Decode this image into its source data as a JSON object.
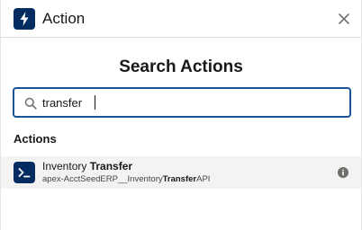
{
  "header": {
    "title": "Action",
    "icon": "lightning-icon",
    "close_icon": "close-icon"
  },
  "search": {
    "heading": "Search Actions",
    "value": "transfer",
    "icon": "search-icon"
  },
  "results": {
    "section_label": "Actions",
    "items": [
      {
        "title_prefix": "Inventory ",
        "title_match": "Transfer",
        "subtitle_prefix": "apex-AcctSeedERP__Inventory",
        "subtitle_match": "Transfer",
        "subtitle_suffix": "API",
        "icon": "terminal-icon",
        "info_icon": "info-icon"
      }
    ]
  },
  "colors": {
    "icon_bg": "#032d60",
    "focus_border": "#1b5297",
    "row_highlight": "#f3f3f3"
  }
}
